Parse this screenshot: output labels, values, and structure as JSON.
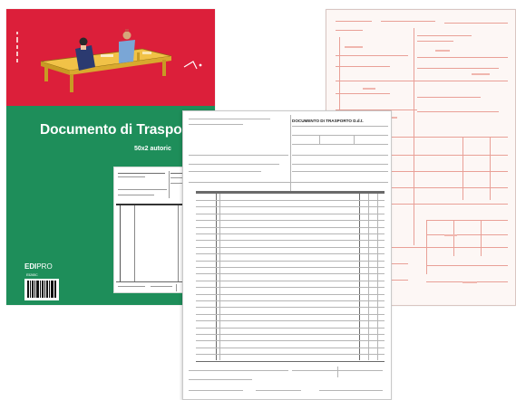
{
  "cover": {
    "title": "Documento di Traspo",
    "subtitle": "50x2 autoric",
    "brand_bold": "EDI",
    "brand_light": "PRO",
    "code": "E5265C"
  },
  "front_form": {
    "title": "DOCUMENTO DI TRASPORTO D.d.t."
  },
  "colors": {
    "cover_red": "#dc1f3a",
    "cover_green": "#1e8e5a",
    "form_red_lines": "#e9a097"
  },
  "icons": {
    "illustration": "table-with-two-figures-icon",
    "barcode": "barcode-icon"
  }
}
